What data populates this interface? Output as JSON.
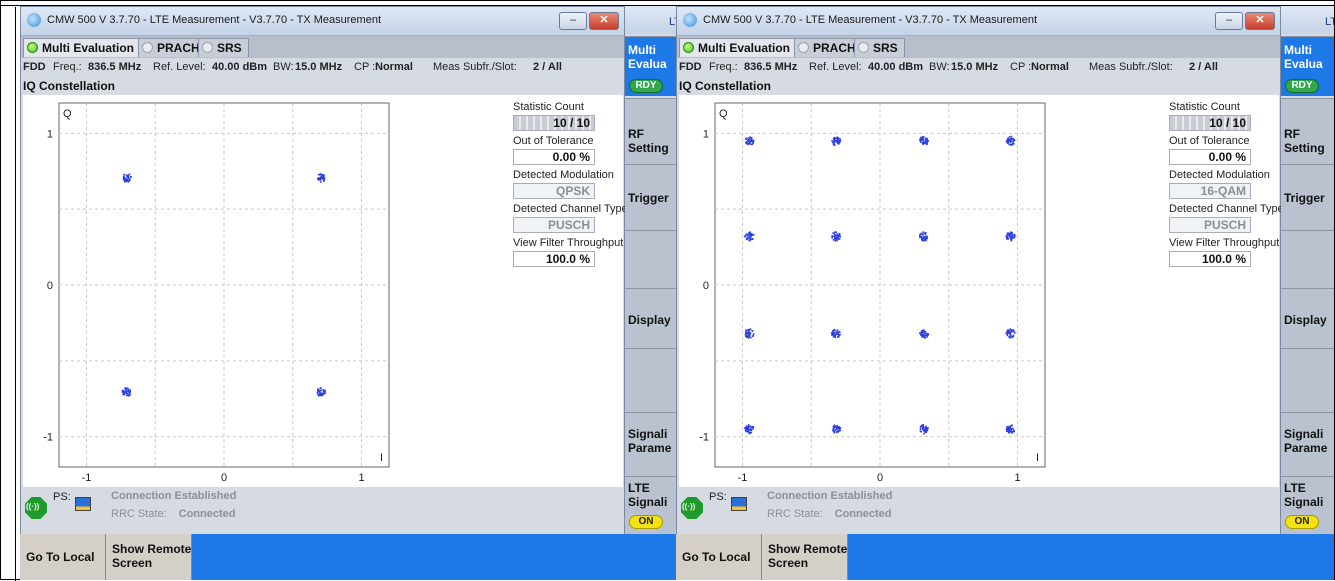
{
  "panes": [
    {
      "window_title": "CMW 500 V 3.7.70 - LTE Measurement  - V3.7.70 - TX Measurement",
      "tabs": [
        "Multi Evaluation",
        "PRACH",
        "SRS"
      ],
      "info": {
        "duplex": "FDD",
        "freq_label": "Freq.:",
        "freq_value": "836.5 MHz",
        "ref_label": "Ref. Level:",
        "ref_value": "40.00 dBm",
        "bw_label": "BW:",
        "bw_value": "15.0 MHz",
        "cp_label": "CP :",
        "cp_value": "Normal",
        "subfr_label": "Meas Subfr./Slot:",
        "subfr_value": "2 / All"
      },
      "section_title": "IQ Constellation",
      "side": {
        "statistic_count_label": "Statistic Count",
        "statistic_count_value": "10 / 10",
        "out_of_tolerance_label": "Out of Tolerance",
        "out_of_tolerance_value": "0.00  %",
        "detected_modulation_label": "Detected Modulation",
        "detected_modulation_value": "QPSK",
        "detected_channel_label": "Detected Channel Type",
        "detected_channel_value": "PUSCH",
        "view_filter_label": "View Filter Throughput",
        "view_filter_value": "100.0  %"
      },
      "status": {
        "ps_label": "PS:",
        "connection": "Connection Established",
        "rrc_label": "RRC State:",
        "rrc_value": "Connected"
      },
      "bottom_buttons": [
        "Go To Local",
        "Show Remote\nScreen"
      ],
      "right_panel": {
        "top_label": "LT",
        "multi_eval": "Multi\nEvalua",
        "rdy": "RDY",
        "rf_setting": "RF\nSetting",
        "trigger": "Trigger",
        "display": "Display",
        "signaling_param": "Signali\nParame",
        "lte_signaling": "LTE\nSignali",
        "on": "ON"
      }
    },
    {
      "window_title": "CMW 500 V 3.7.70 - LTE Measurement  - V3.7.70 - TX Measurement",
      "tabs": [
        "Multi Evaluation",
        "PRACH",
        "SRS"
      ],
      "info": {
        "duplex": "FDD",
        "freq_label": "Freq.:",
        "freq_value": "836.5 MHz",
        "ref_label": "Ref. Level:",
        "ref_value": "40.00 dBm",
        "bw_label": "BW:",
        "bw_value": "15.0 MHz",
        "cp_label": "CP :",
        "cp_value": "Normal",
        "subfr_label": "Meas Subfr./Slot:",
        "subfr_value": "2 / All"
      },
      "section_title": "IQ Constellation",
      "side": {
        "statistic_count_label": "Statistic Count",
        "statistic_count_value": "10 / 10",
        "out_of_tolerance_label": "Out of Tolerance",
        "out_of_tolerance_value": "0.00  %",
        "detected_modulation_label": "Detected Modulation",
        "detected_modulation_value": "16-QAM",
        "detected_channel_label": "Detected Channel Type",
        "detected_channel_value": "PUSCH",
        "view_filter_label": "View Filter Throughput",
        "view_filter_value": "100.0  %"
      },
      "status": {
        "ps_label": "PS:",
        "connection": "Connection Established",
        "rrc_label": "RRC State:",
        "rrc_value": "Connected"
      },
      "bottom_buttons": [
        "Go To Local",
        "Show Remote\nScreen"
      ],
      "right_panel": {
        "top_label": "LT",
        "multi_eval": "Multi\nEvalua",
        "rdy": "RDY",
        "rf_setting": "RF\nSetting",
        "trigger": "Trigger",
        "display": "Display",
        "signaling_param": "Signali\nParame",
        "lte_signaling": "LTE\nSignali",
        "on": "ON"
      }
    }
  ],
  "chart_data": [
    {
      "type": "scatter",
      "title": "IQ Constellation",
      "xlabel": "I",
      "ylabel": "Q",
      "xlim": [
        -1.2,
        1.2
      ],
      "ylim": [
        -1.2,
        1.2
      ],
      "xticks": [
        "-1",
        "0",
        "1"
      ],
      "yticks": [
        "1",
        "0",
        "-1"
      ],
      "grid": true,
      "marker_color": "#2a3ee0",
      "clusters": [
        {
          "x": -0.707,
          "y": 0.707
        },
        {
          "x": 0.707,
          "y": 0.707
        },
        {
          "x": -0.707,
          "y": -0.707
        },
        {
          "x": 0.707,
          "y": -0.707
        }
      ]
    },
    {
      "type": "scatter",
      "title": "IQ Constellation",
      "xlabel": "I",
      "ylabel": "Q",
      "xlim": [
        -1.2,
        1.2
      ],
      "ylim": [
        -1.2,
        1.2
      ],
      "xticks": [
        "-1",
        "0",
        "1"
      ],
      "yticks": [
        "1",
        "0",
        "-1"
      ],
      "grid": true,
      "marker_color": "#2a3ee0",
      "clusters": [
        {
          "x": -0.95,
          "y": 0.95
        },
        {
          "x": -0.32,
          "y": 0.95
        },
        {
          "x": 0.32,
          "y": 0.95
        },
        {
          "x": 0.95,
          "y": 0.95
        },
        {
          "x": -0.95,
          "y": 0.32
        },
        {
          "x": -0.32,
          "y": 0.32
        },
        {
          "x": 0.32,
          "y": 0.32
        },
        {
          "x": 0.95,
          "y": 0.32
        },
        {
          "x": -0.95,
          "y": -0.32
        },
        {
          "x": -0.32,
          "y": -0.32
        },
        {
          "x": 0.32,
          "y": -0.32
        },
        {
          "x": 0.95,
          "y": -0.32
        },
        {
          "x": -0.95,
          "y": -0.95
        },
        {
          "x": -0.32,
          "y": -0.95
        },
        {
          "x": 0.32,
          "y": -0.95
        },
        {
          "x": 0.95,
          "y": -0.95
        }
      ]
    }
  ]
}
